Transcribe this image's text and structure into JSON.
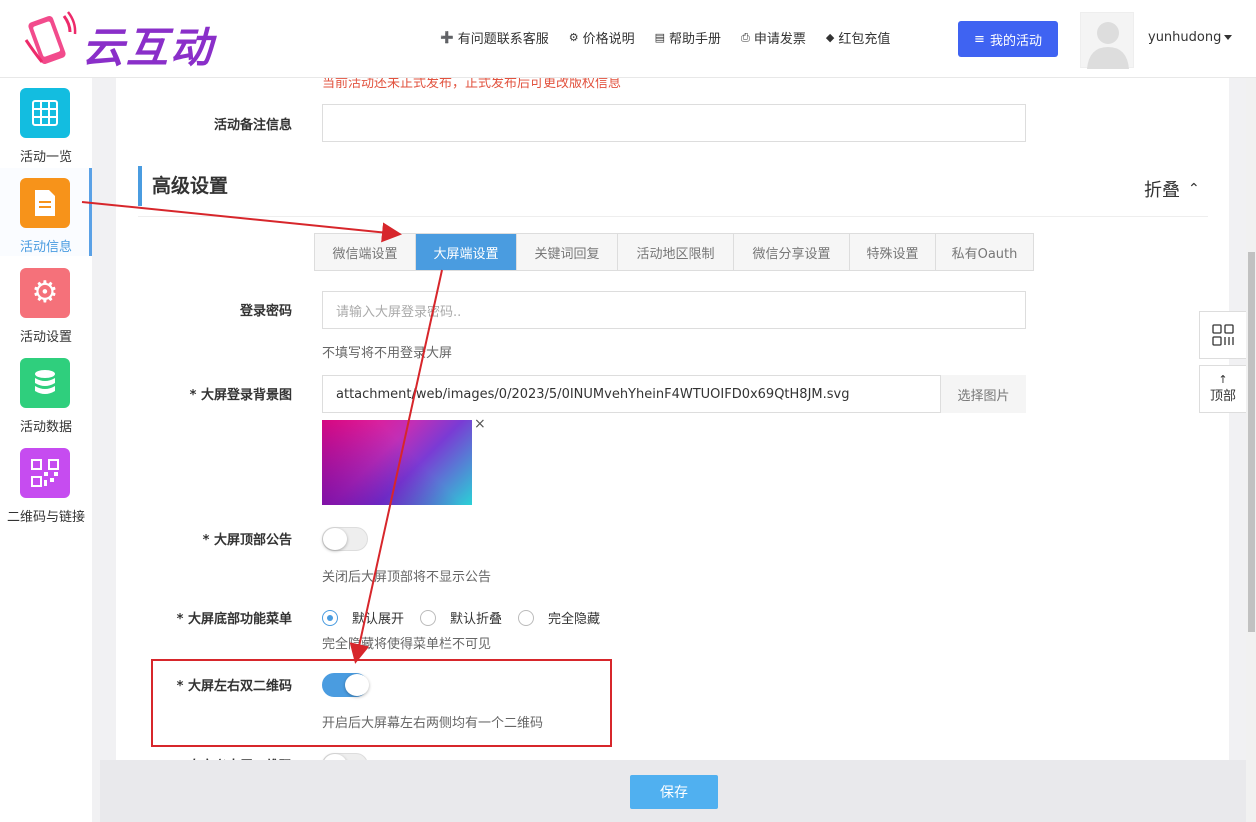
{
  "header": {
    "logo_text": "云互动",
    "nav": [
      {
        "icon": "user-plus-icon",
        "label": "有问题联系客服"
      },
      {
        "icon": "gear-icon",
        "label": "价格说明"
      },
      {
        "icon": "book-icon",
        "label": "帮助手册"
      },
      {
        "icon": "printer-icon",
        "label": "申请发票"
      },
      {
        "icon": "shield-check-icon",
        "label": "红包充值"
      }
    ],
    "my_activity_label": "我的活动",
    "username": "yunhudong"
  },
  "sidebar": {
    "items": [
      {
        "label": "活动一览",
        "icon": "grid-icon",
        "color": "#13bde0"
      },
      {
        "label": "活动信息",
        "icon": "document-icon",
        "color": "#f7931a"
      },
      {
        "label": "活动设置",
        "icon": "gear-icon",
        "color": "#f5717a"
      },
      {
        "label": "活动数据",
        "icon": "database-icon",
        "color": "#2fcf7d"
      },
      {
        "label": "二维码与链接",
        "icon": "qrcode-icon",
        "color": "#c64cf0"
      }
    ],
    "active_index": 1
  },
  "form": {
    "warning_text": "当前活动还未正式发布，正式发布后可更改版权信息",
    "remark_label": "活动备注信息",
    "remark_value": "",
    "section_title": "高级设置",
    "fold_label": "折叠",
    "tabs": [
      "微信端设置",
      "大屏端设置",
      "关键词回复",
      "活动地区限制",
      "微信分享设置",
      "特殊设置",
      "私有Oauth"
    ],
    "active_tab": 1,
    "login_password": {
      "label": "登录密码",
      "placeholder": "请输入大屏登录密码..",
      "help": "不填写将不用登录大屏"
    },
    "login_bg": {
      "label": "* 大屏登录背景图",
      "value": "attachment/web/images/0/2023/5/0INUMvehYheinF4WTUOIFD0x69QtH8JM.svg",
      "choose_label": "选择图片",
      "close_glyph": "×"
    },
    "top_notice": {
      "label": "* 大屏顶部公告",
      "enabled": false,
      "help": "关闭后大屏顶部将不显示公告"
    },
    "bottom_menu": {
      "label": "* 大屏底部功能菜单",
      "options": [
        "默认展开",
        "默认折叠",
        "完全隐藏"
      ],
      "selected": 0,
      "help": "完全隐藏将使得菜单栏不可见"
    },
    "dual_qrcode": {
      "label": "* 大屏左右双二维码",
      "enabled": true,
      "help": "开启后大屏幕左右两侧均有一个二维码"
    },
    "custom_qrcode": {
      "label": "* 自定义大屏二维码",
      "enabled": false
    }
  },
  "footer": {
    "save_label": "保存"
  },
  "floating": {
    "qrcode_icon": "qrcode-icon",
    "top_label": "顶部",
    "top_arrow": "↑"
  },
  "colors": {
    "primary": "#4a9ce0",
    "my_activity_btn": "#3f63f2",
    "save_btn": "#50b0f0",
    "annotation_red": "#d7262b",
    "warning": "#e2533f"
  }
}
